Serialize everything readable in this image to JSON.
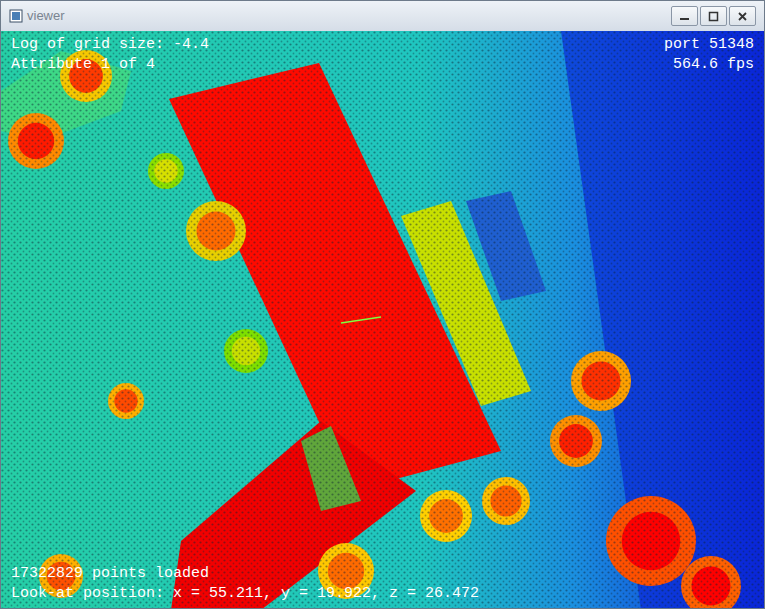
{
  "window": {
    "title": "viewer"
  },
  "overlay": {
    "top_left": [
      "Log of grid size: -4.4",
      "Attribute 1 of 4"
    ],
    "top_right": [
      "port 51348",
      "564.6 fps"
    ],
    "bottom_left": [
      "17322829 points loaded",
      "Look-at position: x = 55.211, y = 19.922, z = 26.472"
    ]
  }
}
